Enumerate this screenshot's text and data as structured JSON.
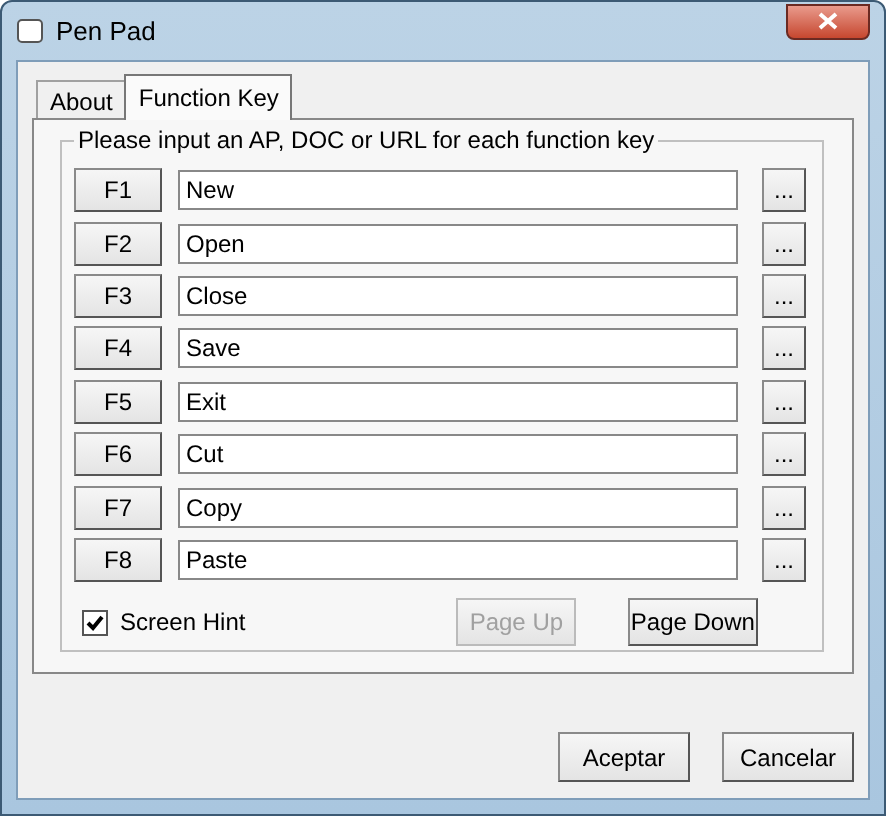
{
  "window": {
    "title": "Pen Pad"
  },
  "tabs": [
    {
      "label": "About",
      "selected": false
    },
    {
      "label": "Function Key",
      "selected": true
    }
  ],
  "group": {
    "label": "Please input an AP, DOC or URL for each function key"
  },
  "keys": [
    {
      "key": "F1",
      "value": "New",
      "browse": "..."
    },
    {
      "key": "F2",
      "value": "Open",
      "browse": "..."
    },
    {
      "key": "F3",
      "value": "Close",
      "browse": "..."
    },
    {
      "key": "F4",
      "value": "Save",
      "browse": "..."
    },
    {
      "key": "F5",
      "value": "Exit",
      "browse": "..."
    },
    {
      "key": "F6",
      "value": "Cut",
      "browse": "..."
    },
    {
      "key": "F7",
      "value": "Copy",
      "browse": "..."
    },
    {
      "key": "F8",
      "value": "Paste",
      "browse": "..."
    }
  ],
  "screen_hint": {
    "label": "Screen Hint",
    "checked": true
  },
  "paging": [
    {
      "label": "Page Up",
      "disabled": true
    },
    {
      "label": "Page Down",
      "disabled": false
    }
  ],
  "buttons": [
    "Aceptar",
    "Cancelar"
  ]
}
